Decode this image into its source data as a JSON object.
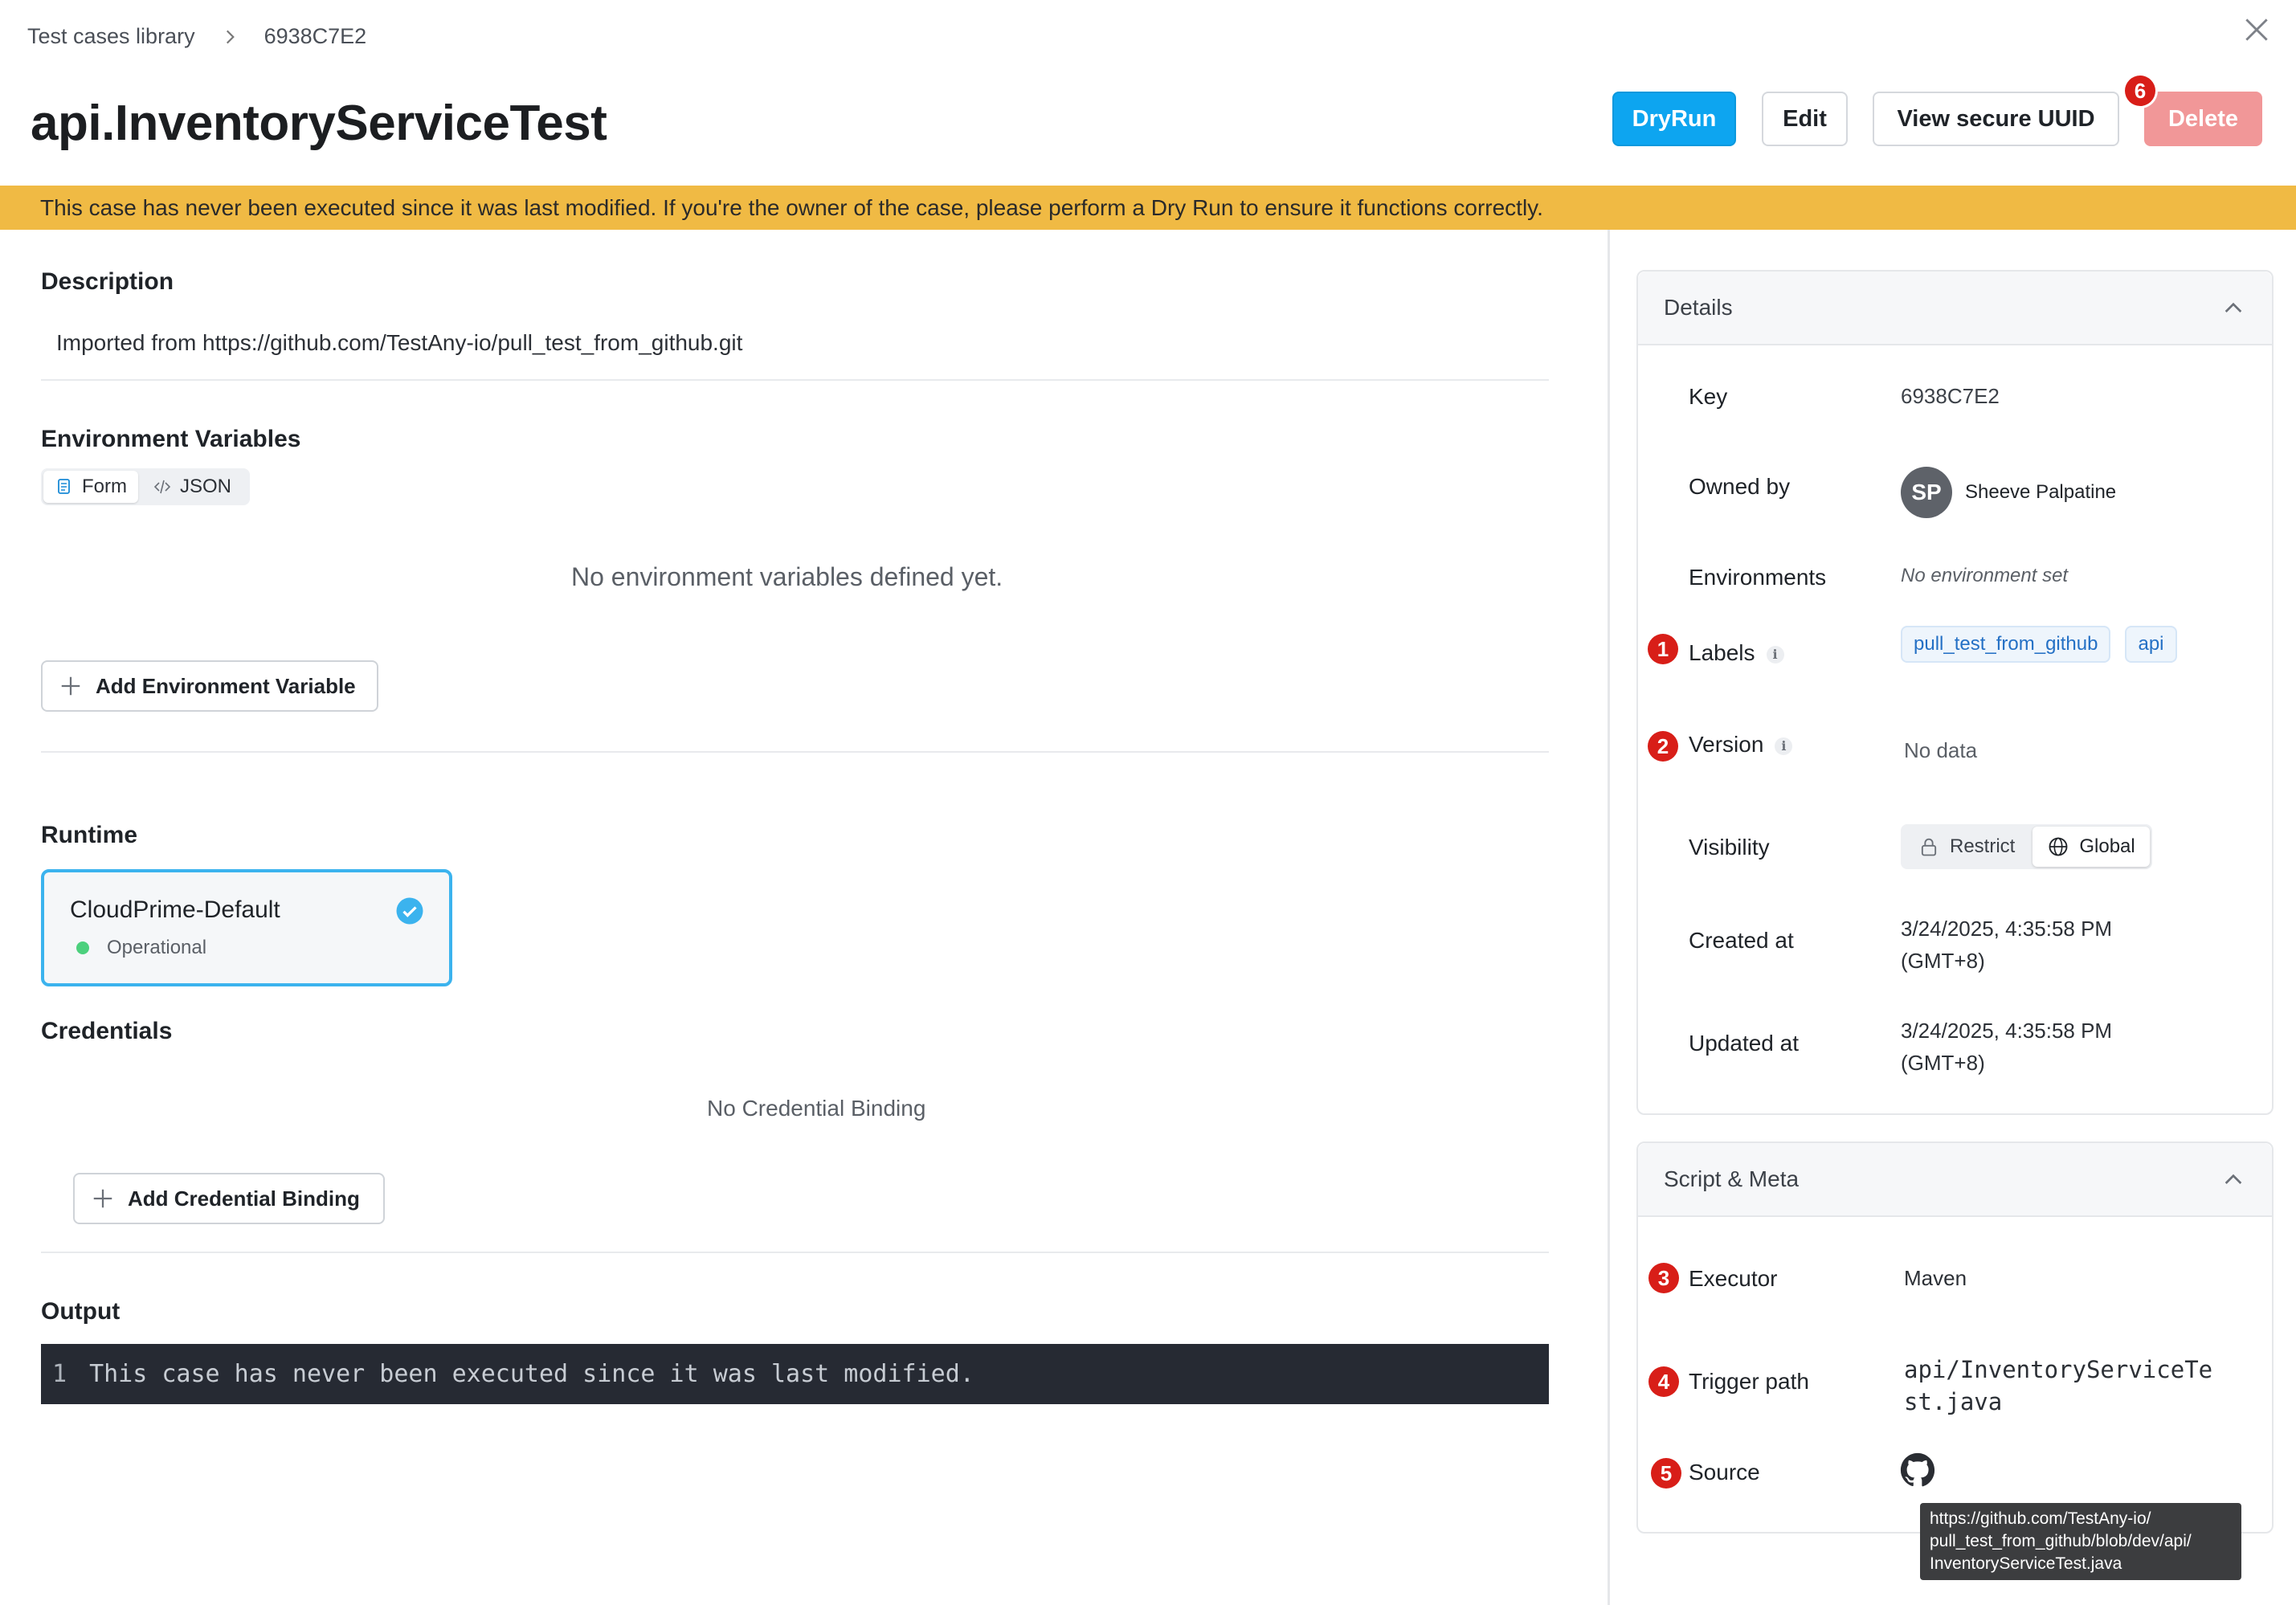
{
  "breadcrumb": {
    "root": "Test cases library",
    "current": "6938C7E2"
  },
  "page": {
    "title": "api.InventoryServiceTest"
  },
  "actions": {
    "dryrun": "DryRun",
    "edit": "Edit",
    "view_uuid": "View secure UUID",
    "delete": "Delete"
  },
  "banner": {
    "text": "This case has never been executed since it was last modified. If you're the owner of the case, please perform a Dry Run to ensure it functions correctly."
  },
  "description": {
    "heading": "Description",
    "text": "Imported from https://github.com/TestAny-io/pull_test_from_github.git"
  },
  "env_vars": {
    "heading": "Environment Variables",
    "tabs": [
      {
        "label": "Form",
        "active": true
      },
      {
        "label": "JSON",
        "active": false
      }
    ],
    "empty_text": "No environment variables defined yet.",
    "add_button": "Add Environment Variable"
  },
  "runtime": {
    "heading": "Runtime",
    "name": "CloudPrime-Default",
    "status": "Operational"
  },
  "credentials": {
    "heading": "Credentials",
    "empty_text": "No Credential Binding",
    "add_button": "Add Credential Binding"
  },
  "output": {
    "heading": "Output",
    "line_number": "1",
    "line_text": "This case has never been executed since it was last modified."
  },
  "details": {
    "title": "Details",
    "key_label": "Key",
    "key_value": "6938C7E2",
    "owner_label": "Owned by",
    "owner_initials": "SP",
    "owner_name": "Sheeve Palpatine",
    "env_label": "Environments",
    "env_value": "No environment set",
    "labels_label": "Labels",
    "labels": [
      "pull_test_from_github",
      "api"
    ],
    "version_label": "Version",
    "version_value": "No data",
    "visibility_label": "Visibility",
    "visibility_options": [
      "Restrict",
      "Global"
    ],
    "visibility_selected": "Global",
    "created_label": "Created at",
    "created_value_line1": "3/24/2025, 4:35:58 PM",
    "created_value_line2": "(GMT+8)",
    "updated_label": "Updated at",
    "updated_value_line1": "3/24/2025, 4:35:58 PM",
    "updated_value_line2": "(GMT+8)"
  },
  "script_meta": {
    "title": "Script & Meta",
    "executor_label": "Executor",
    "executor_value": "Maven",
    "trigger_label": "Trigger path",
    "trigger_value_line1": "api/InventoryServiceTe",
    "trigger_value_line2": "st.java",
    "source_label": "Source",
    "source_icon": "github-icon"
  },
  "tooltip": {
    "lines": [
      "https://github.com/TestAny-io/",
      "pull_test_from_github/blob/dev/api/",
      "InventoryServiceTest.java"
    ]
  },
  "markers": [
    "1",
    "2",
    "3",
    "4",
    "5",
    "6"
  ],
  "colors": {
    "accent": "#0da5f0",
    "banner": "#f0ba44",
    "delete": "#f19798",
    "marker": "#d81e18",
    "runtime_border": "#3bb3ee",
    "operational": "#4cd07d",
    "output_bg": "#262a33"
  }
}
